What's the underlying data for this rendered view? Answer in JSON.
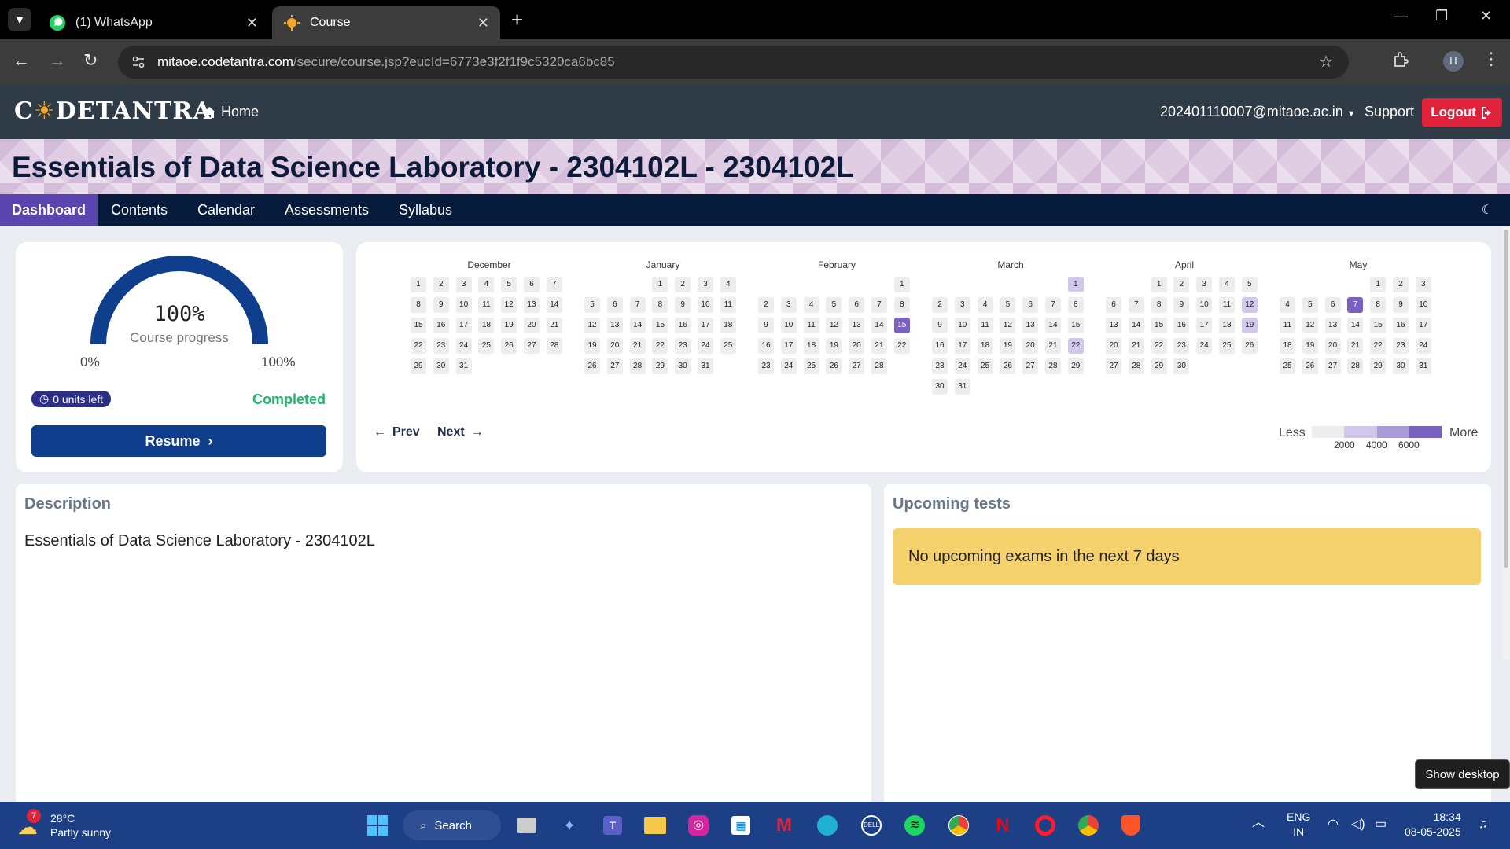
{
  "browser": {
    "tabs": [
      {
        "title": "(1) WhatsApp",
        "icon": "whatsapp-icon",
        "active": false
      },
      {
        "title": "Course",
        "icon": "codetantra-icon",
        "active": true
      }
    ],
    "url_host": "mitaoe.codetantra.com",
    "url_path": "/secure/course.jsp?eucId=6773e3f2f1f9c5320ca6bc85",
    "profile_initial": "H"
  },
  "app": {
    "brand": "CODETANTRA",
    "home_label": "Home",
    "user_email": "202401110007@mitaoe.ac.in",
    "support_label": "Support",
    "logout_label": "Logout"
  },
  "course": {
    "title": "Essentials of Data Science Laboratory - 2304102L - 2304102L"
  },
  "tabs": [
    "Dashboard",
    "Contents",
    "Calendar",
    "Assessments",
    "Syllabus"
  ],
  "active_tab": "Dashboard",
  "progress": {
    "value_label": "100%",
    "value": 100,
    "caption": "Course progress",
    "min_label": "0%",
    "max_label": "100%",
    "units_left": "0 units left",
    "status": "Completed",
    "resume_label": "Resume"
  },
  "calendar": {
    "prev_label": "Prev",
    "next_label": "Next",
    "legend_less": "Less",
    "legend_more": "More",
    "legend_ticks": [
      "2000",
      "4000",
      "6000"
    ],
    "legend_colors": [
      "#ededed",
      "#d1c8ec",
      "#a99ad8",
      "#7a61c0"
    ],
    "months": [
      {
        "name": "December",
        "start": 0,
        "days": 31,
        "activity": {}
      },
      {
        "name": "January",
        "start": 3,
        "days": 31,
        "activity": {}
      },
      {
        "name": "February",
        "start": 6,
        "days": 28,
        "activity": {
          "15": 3
        }
      },
      {
        "name": "March",
        "start": 6,
        "days": 31,
        "activity": {
          "1": 1,
          "22": 1
        }
      },
      {
        "name": "April",
        "start": 2,
        "days": 30,
        "activity": {
          "12": 1,
          "19": 1
        }
      },
      {
        "name": "May",
        "start": 4,
        "days": 31,
        "activity": {
          "7": 3
        }
      }
    ]
  },
  "description": {
    "heading": "Description",
    "text": "Essentials of Data Science Laboratory - 2304102L"
  },
  "upcoming": {
    "heading": "Upcoming tests",
    "message": "No upcoming exams in the next 7 days"
  },
  "tooltip": "Show desktop",
  "taskbar": {
    "weather_temp": "28°C",
    "weather_desc": "Partly sunny",
    "weather_badge": "7",
    "search_label": "Search",
    "lang_top": "ENG",
    "lang_bottom": "IN",
    "time": "18:34",
    "date": "08-05-2025"
  }
}
